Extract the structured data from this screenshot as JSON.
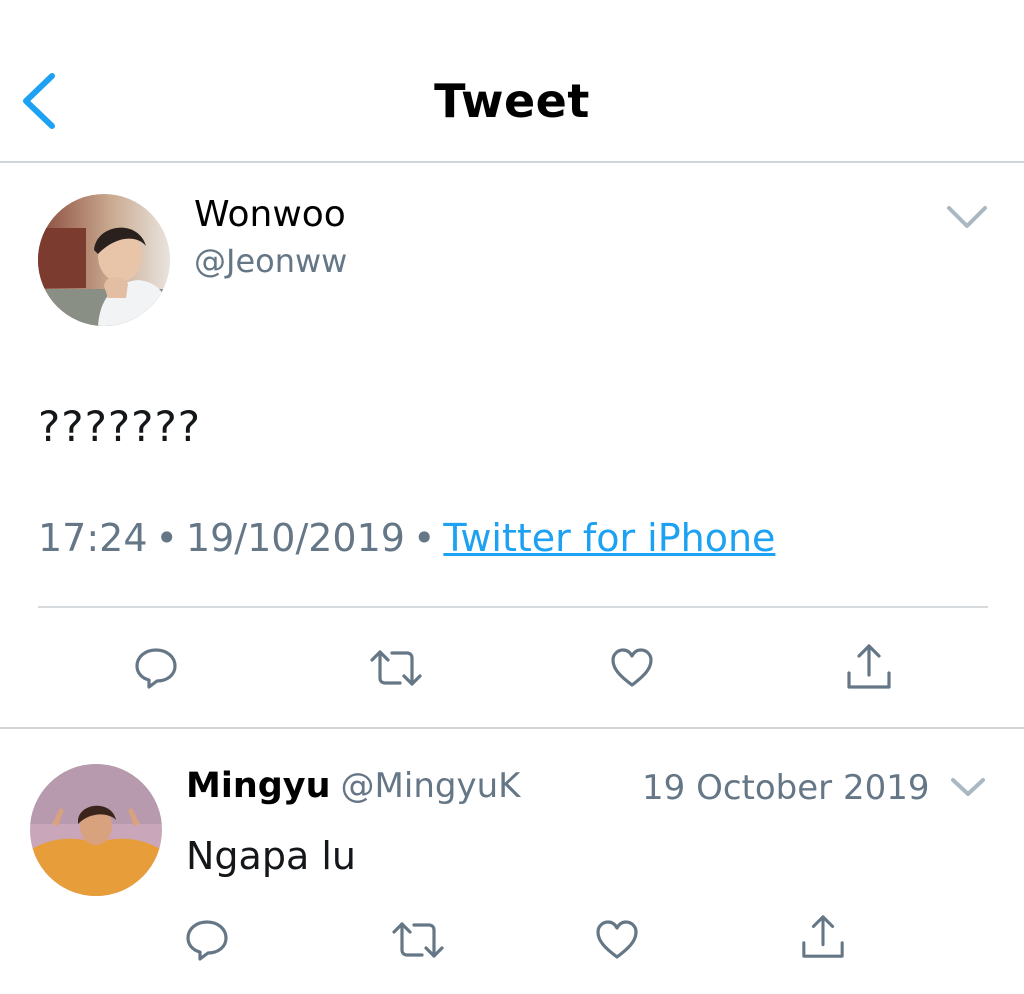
{
  "header": {
    "title": "Tweet",
    "back_icon": "chevron-left-icon",
    "accent_color": "#1da1f2"
  },
  "tweet": {
    "author": {
      "name": "Wonwoo",
      "handle": "@Jeonww",
      "avatar_icon": "avatar-photo"
    },
    "text": "???????",
    "time": "17:24",
    "date": "19/10/2019",
    "separator": "•",
    "source": "Twitter for iPhone",
    "menu_icon": "chevron-down-icon",
    "actions": [
      {
        "name": "reply",
        "icon": "reply-icon"
      },
      {
        "name": "retweet",
        "icon": "retweet-icon"
      },
      {
        "name": "like",
        "icon": "heart-icon"
      },
      {
        "name": "share",
        "icon": "share-icon"
      }
    ]
  },
  "reply": {
    "author": {
      "name": "Mingyu",
      "handle": "@MingyuK",
      "avatar_icon": "avatar-photo"
    },
    "date": "19 October 2019",
    "text": "Ngapa lu",
    "menu_icon": "chevron-down-icon"
  },
  "colors": {
    "text_primary": "#14171a",
    "text_secondary": "#657786",
    "link": "#1da1f2",
    "icon": "#657786",
    "divider": "#cfd4d8"
  }
}
